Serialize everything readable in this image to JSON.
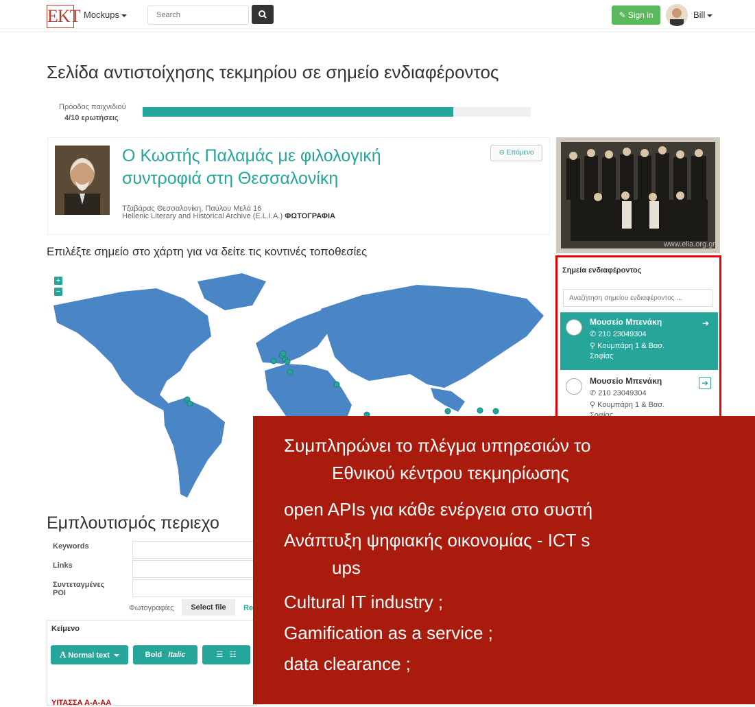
{
  "navbar": {
    "logo_text": "EKT",
    "menu_label": "Mockups",
    "search_placeholder": "Search",
    "signin_label": "Sign in",
    "user_name": "Bill"
  },
  "page": {
    "title": "Σελίδα αντιστοίχησης τεκμηρίου σε σημείο ενδιαφέροντος"
  },
  "progress": {
    "label": "Πρόοδος παιχνιδιού",
    "value_text": "4/10 ερωτήσεις",
    "fraction": 0.8
  },
  "item": {
    "title_line1": "Ο Κωστής Παλαμάς με φιλολογική",
    "title_line2": "συντροφιά στη Θεσσαλονίκη",
    "address": "Τζαβάρας Θεσσαλονίκη, Παύλου Μελά 16",
    "source": "Hellenic Literary and Historical Archive (E.L.I.A.)",
    "type": "ΦΩΤΟΓΡΑΦΙΑ",
    "next_label": "Επόμενο"
  },
  "photo": {
    "watermark": "www.elia.org.gr"
  },
  "map": {
    "title": "Επιλέξτε σημείο στο χάρτη για να δείτε τις κοντινές τοποθεσίες",
    "zoom_in": "+",
    "zoom_out": "−"
  },
  "poi": {
    "header": "Σημεία ενδιαφέροντος",
    "search_placeholder": "Αναζήτηση σημείου ενδιαφέροντος ...",
    "items": [
      {
        "name": "Μουσείο Μπενάκη",
        "phone": "210 23049304",
        "address": "Κουμπάρη 1 & Βασ. Σοφίας",
        "active": true
      },
      {
        "name": "Μουσείο Μπενάκη",
        "phone": "210 23049304",
        "address": "Κουμπάρη 1 & Βασ. Σοφίας",
        "active": false
      }
    ]
  },
  "enrich": {
    "title": "Εμπλουτισμός περιεχο",
    "keywords_label": "Keywords",
    "links_label": "Links",
    "coords_label_1": "Συντεταγμένες",
    "coords_label_2": "POI",
    "photos_label": "Φωτογραφίες",
    "select_file_label": "Select file",
    "remove_label": "Re",
    "text_label": "Κείμενο",
    "toolbar": {
      "normal_text": "Normal text",
      "bold": "Bold",
      "italic": "Italic"
    },
    "partial_red_text": "ΥΙΤΑΣΣΑ Α-Α-ΑΑ"
  },
  "overlay": {
    "lines": [
      "Συμπληρώνει το πλέγμα υπηρεσιών το",
      "Εθνικού κέντρου τεκμηρίωσης",
      "open APIs για κάθε ενέργεια στο συστή",
      "Ανάπτυξη ψηφιακής οικονομίας - ICT s",
      "ups",
      "Cultural IT industry ;",
      "Gamification as a service ;",
      "data clearance ;"
    ],
    "background": "#a91b0d"
  },
  "colors": {
    "accent": "#26a69a",
    "signin": "#5cb85c",
    "highlight": "#ee0000"
  }
}
